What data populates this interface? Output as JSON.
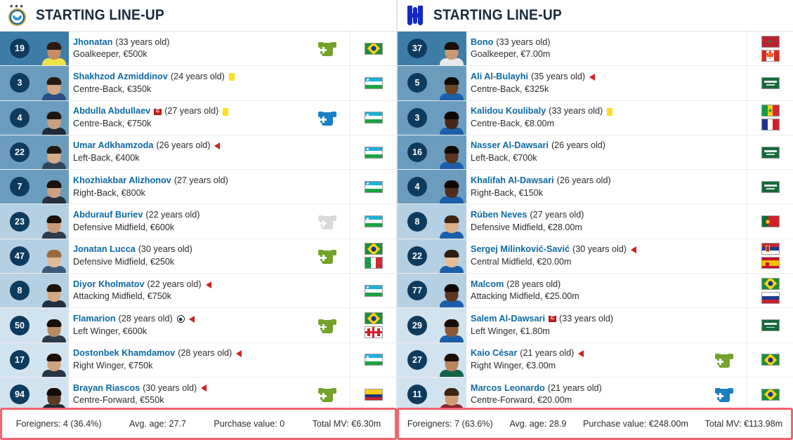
{
  "teams": [
    {
      "id": "pakhtakor",
      "logo_name": "pakhtakor-crest-icon",
      "title": "STARTING LINE-UP",
      "players": [
        {
          "number": "19",
          "name": "Jhonatan",
          "age": "(33 years old)",
          "position": "Goalkeeper, €500k",
          "group": "gk",
          "captain": false,
          "yellow": false,
          "sub_out": false,
          "goal": false,
          "sub_icon": "in",
          "flags": [
            "brazil"
          ],
          "skin": "#c98b62",
          "hair": "#2b1a12",
          "kit": "#f0e24a"
        },
        {
          "number": "3",
          "name": "Shakhzod Azmiddinov",
          "age": "(24 years old)",
          "position": "Centre-Back, €350k",
          "group": "def",
          "captain": false,
          "yellow": true,
          "sub_out": false,
          "goal": false,
          "sub_icon": "none",
          "flags": [
            "uzbekistan"
          ],
          "skin": "#d6a783",
          "hair": "#2a1b12",
          "kit": "#2b4d86"
        },
        {
          "number": "4",
          "name": "Abdulla Abdullaev",
          "age": "(27 years old)",
          "position": "Centre-Back, €750k",
          "group": "def",
          "captain": true,
          "yellow": true,
          "sub_out": false,
          "goal": false,
          "sub_icon": "out",
          "flags": [
            "uzbekistan"
          ],
          "skin": "#caa080",
          "hair": "#20150e",
          "kit": "#1f2b3a"
        },
        {
          "number": "22",
          "name": "Umar Adkhamzoda",
          "age": "(26 years old)",
          "position": "Left-Back, €400k",
          "group": "def",
          "captain": false,
          "yellow": false,
          "sub_out": true,
          "goal": false,
          "sub_icon": "none",
          "flags": [
            "uzbekistan"
          ],
          "skin": "#d9ab86",
          "hair": "#241810",
          "kit": "#30465e"
        },
        {
          "number": "7",
          "name": "Khozhiakbar Alizhonov",
          "age": "(27 years old)",
          "position": "Right-Back, €800k",
          "group": "def",
          "captain": false,
          "yellow": false,
          "sub_out": false,
          "goal": false,
          "sub_icon": "none",
          "flags": [
            "uzbekistan"
          ],
          "skin": "#cfa07c",
          "hair": "#1d120c",
          "kit": "#25313f"
        },
        {
          "number": "23",
          "name": "Abdurauf Buriev",
          "age": "(22 years old)",
          "position": "Defensive Midfield, €600k",
          "group": "mid",
          "captain": false,
          "yellow": false,
          "sub_out": false,
          "goal": false,
          "sub_icon": "muted",
          "flags": [
            "uzbekistan"
          ],
          "skin": "#c99a77",
          "hair": "#1b1009",
          "kit": "#2d3b4b"
        },
        {
          "number": "47",
          "name": "Jonatan Lucca",
          "age": "(30 years old)",
          "position": "Defensive Midfield, €250k",
          "group": "mid",
          "captain": false,
          "yellow": false,
          "sub_out": false,
          "goal": false,
          "sub_icon": "in",
          "flags": [
            "brazil",
            "italy"
          ],
          "skin": "#e3b894",
          "hair": "#9a6a3c",
          "kit": "#3a5a7a"
        },
        {
          "number": "8",
          "name": "Diyor Kholmatov",
          "age": "(22 years old)",
          "position": "Attacking Midfield, €750k",
          "group": "mid",
          "captain": false,
          "yellow": false,
          "sub_out": true,
          "goal": false,
          "sub_icon": "none",
          "flags": [
            "uzbekistan"
          ],
          "skin": "#d4a883",
          "hair": "#201409",
          "kit": "#22303f"
        },
        {
          "number": "50",
          "name": "Flamarion",
          "age": "(28 years old)",
          "position": "Left Winger, €600k",
          "group": "fwd",
          "captain": false,
          "yellow": false,
          "sub_out": true,
          "goal": true,
          "sub_icon": "in",
          "flags": [
            "brazil",
            "georgia"
          ],
          "skin": "#b98a62",
          "hair": "#17100a",
          "kit": "#2a3a4c"
        },
        {
          "number": "17",
          "name": "Dostonbek Khamdamov",
          "age": "(28 years old)",
          "position": "Right Winger, €750k",
          "group": "fwd",
          "captain": false,
          "yellow": false,
          "sub_out": true,
          "goal": false,
          "sub_icon": "none",
          "flags": [
            "uzbekistan"
          ],
          "skin": "#cfa17d",
          "hair": "#1a1009",
          "kit": "#273544"
        },
        {
          "number": "94",
          "name": "Brayan Riascos",
          "age": "(30 years old)",
          "position": "Centre-Forward, €550k",
          "group": "fwd",
          "captain": false,
          "yellow": false,
          "sub_out": true,
          "goal": false,
          "sub_icon": "in",
          "flags": [
            "colombia"
          ],
          "skin": "#5d3a26",
          "hair": "#120b06",
          "kit": "#1e2a36"
        }
      ],
      "footer": {
        "foreigners": "Foreigners: 4 (36.4%)",
        "avg_age": "Avg. age: 27.7",
        "purchase_value": "Purchase value: 0",
        "total_mv": "Total MV: €6.30m"
      }
    },
    {
      "id": "alhilal",
      "logo_name": "al-hilal-crest-icon",
      "title": "STARTING LINE-UP",
      "players": [
        {
          "number": "37",
          "name": "Bono",
          "age": "(33 years old)",
          "position": "Goalkeeper, €7.00m",
          "group": "gk",
          "captain": false,
          "yellow": false,
          "sub_out": false,
          "goal": false,
          "sub_icon": "none",
          "flags": [
            "morocco",
            "canada"
          ],
          "skin": "#c99871",
          "hair": "#1a1009",
          "kit": "#e8e8e8"
        },
        {
          "number": "5",
          "name": "Ali Al-Bulayhi",
          "age": "(35 years old)",
          "position": "Centre-Back, €325k",
          "group": "def",
          "captain": false,
          "yellow": false,
          "sub_out": true,
          "goal": false,
          "sub_icon": "none",
          "flags": [
            "saudi"
          ],
          "skin": "#6b4329",
          "hair": "#120b06",
          "kit": "#1b5faa"
        },
        {
          "number": "3",
          "name": "Kalidou Koulibaly",
          "age": "(33 years old)",
          "position": "Centre-Back, €8.00m",
          "group": "def",
          "captain": false,
          "yellow": true,
          "sub_out": false,
          "goal": false,
          "sub_icon": "none",
          "flags": [
            "senegal",
            "france"
          ],
          "skin": "#43281a",
          "hair": "#0d0704",
          "kit": "#1b5faa"
        },
        {
          "number": "16",
          "name": "Nasser Al-Dawsari",
          "age": "(26 years old)",
          "position": "Left-Back, €700k",
          "group": "def",
          "captain": false,
          "yellow": false,
          "sub_out": false,
          "goal": false,
          "sub_icon": "none",
          "flags": [
            "saudi"
          ],
          "skin": "#5a3620",
          "hair": "#100a05",
          "kit": "#1b5faa"
        },
        {
          "number": "4",
          "name": "Khalifah Al-Dawsari",
          "age": "(26 years old)",
          "position": "Right-Back, €150k",
          "group": "def",
          "captain": false,
          "yellow": false,
          "sub_out": false,
          "goal": false,
          "sub_icon": "none",
          "flags": [
            "saudi"
          ],
          "skin": "#4d2e1c",
          "hair": "#0e0804",
          "kit": "#1b5faa"
        },
        {
          "number": "8",
          "name": "Rúben Neves",
          "age": "(27 years old)",
          "position": "Defensive Midfield, €28.00m",
          "group": "mid",
          "captain": false,
          "yellow": false,
          "sub_out": false,
          "goal": false,
          "sub_icon": "none",
          "flags": [
            "portugal"
          ],
          "skin": "#dcb089",
          "hair": "#3a2414",
          "kit": "#1b5faa"
        },
        {
          "number": "22",
          "name": "Sergej Milinković-Savić",
          "age": "(30 years old)",
          "position": "Central Midfield, €20.00m",
          "group": "mid",
          "captain": false,
          "yellow": false,
          "sub_out": true,
          "goal": false,
          "sub_icon": "none",
          "flags": [
            "serbia",
            "spain"
          ],
          "skin": "#e4bd99",
          "hair": "#2d1d10",
          "kit": "#1b5faa"
        },
        {
          "number": "77",
          "name": "Malcom",
          "age": "(28 years old)",
          "position": "Attacking Midfield, €25.00m",
          "group": "mid",
          "captain": false,
          "yellow": false,
          "sub_out": false,
          "goal": false,
          "sub_icon": "none",
          "flags": [
            "brazil",
            "russia"
          ],
          "skin": "#5b3622",
          "hair": "#0f0905",
          "kit": "#1b5faa"
        },
        {
          "number": "29",
          "name": "Salem Al-Dawsari",
          "age": "(33 years old)",
          "position": "Left Winger, €1.80m",
          "group": "fwd",
          "captain": true,
          "yellow": false,
          "sub_out": false,
          "goal": false,
          "sub_icon": "none",
          "flags": [
            "saudi"
          ],
          "skin": "#8a5a38",
          "hair": "#150d07",
          "kit": "#1b5faa"
        },
        {
          "number": "27",
          "name": "Kaio César",
          "age": "(21 years old)",
          "position": "Right Winger, €3.00m",
          "group": "fwd",
          "captain": false,
          "yellow": false,
          "sub_out": true,
          "goal": false,
          "sub_icon": "in",
          "flags": [
            "brazil"
          ],
          "skin": "#b98660",
          "hair": "#1a1008",
          "kit": "#14624a"
        },
        {
          "number": "11",
          "name": "Marcos Leonardo",
          "age": "(21 years old)",
          "position": "Centre-Forward, €20.00m",
          "group": "fwd",
          "captain": false,
          "yellow": false,
          "sub_out": false,
          "goal": false,
          "sub_icon": "out",
          "flags": [
            "brazil"
          ],
          "skin": "#cf9e76",
          "hair": "#3a2413",
          "kit": "#8d2430"
        }
      ],
      "footer": {
        "foreigners": "Foreigners: 7 (63.6%)",
        "avg_age": "Avg. age: 28.9",
        "purchase_value": "Purchase value: €248.00m",
        "total_mv": "Total MV: €113.98m"
      }
    }
  ],
  "colors": {
    "gk": "#3d7da8",
    "def": "#6b9cbd",
    "mid": "#b4d0e2",
    "fwd": "#d2e3f0",
    "badge": "#0e3a5c",
    "link": "#0d6aa3",
    "footer_border": "#f4636f"
  }
}
